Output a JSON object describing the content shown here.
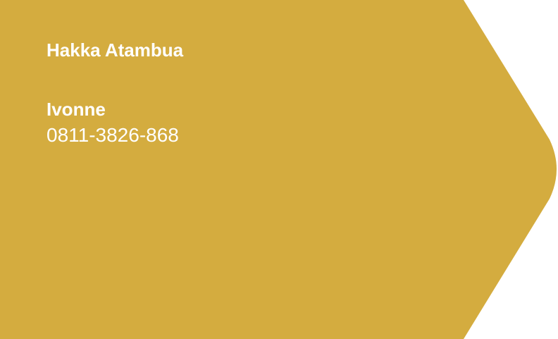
{
  "card": {
    "fill_color": "#D4AC3F",
    "text_color": "#FFFFFF",
    "organization": "Hakka Atambua",
    "contact_name": "Ivonne",
    "phone": "0811-3826-868"
  }
}
